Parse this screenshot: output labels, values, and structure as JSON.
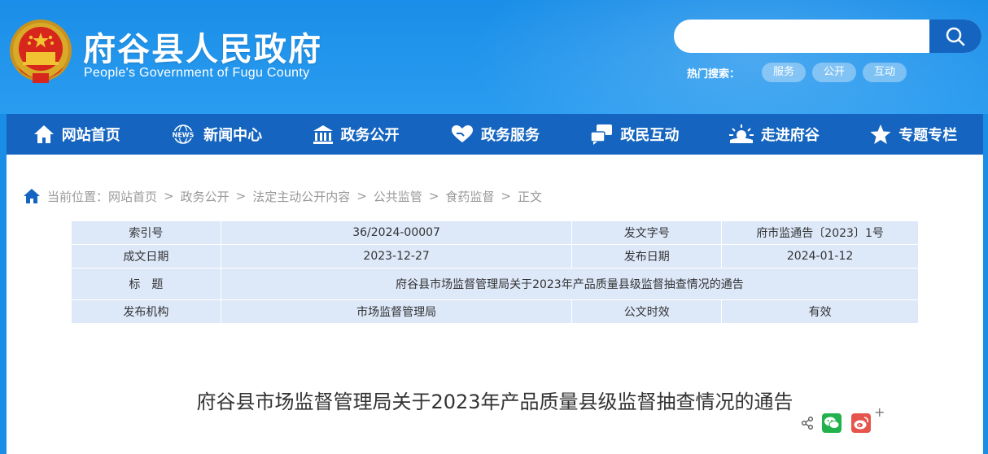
{
  "header": {
    "title": "府谷县人民政府",
    "subtitle": "People's Government of Fugu County",
    "search": {
      "placeholder": "",
      "button": "search"
    },
    "hot_label": "热门搜索：",
    "hot_tags": [
      "服务",
      "公开",
      "互动"
    ]
  },
  "nav": [
    {
      "label": "网站首页",
      "icon": "home-icon"
    },
    {
      "label": "新闻中心",
      "icon": "news-icon"
    },
    {
      "label": "政务公开",
      "icon": "building-icon"
    },
    {
      "label": "政务服务",
      "icon": "heart-hand-icon"
    },
    {
      "label": "政民互动",
      "icon": "chat-icon"
    },
    {
      "label": "走进府谷",
      "icon": "sunrise-icon"
    },
    {
      "label": "专题专栏",
      "icon": "star-icon"
    }
  ],
  "breadcrumb": {
    "label": "当前位置：",
    "items": [
      "网站首页",
      "政务公开",
      "法定主动公开内容",
      "公共监管",
      "食药监督"
    ],
    "current": "正文",
    "separator": ">"
  },
  "info": {
    "index_label": "索引号",
    "index_value": "36/2024-00007",
    "doc_no_label": "发文字号",
    "doc_no_value": "府市监通告〔2023〕1号",
    "date_label": "成文日期",
    "date_value": "2023-12-27",
    "publish_label": "发布日期",
    "publish_value": "2024-01-12",
    "title_label": "标　题",
    "title_value": "府谷县市场监督管理局关于2023年产品质量县级监督抽查情况的通告",
    "org_label": "发布机构",
    "org_value": "市场监督管理局",
    "validity_label": "公文时效",
    "validity_value": "有效"
  },
  "article": {
    "title": "府谷县市场监督管理局关于2023年产品质量县级监督抽查情况的通告"
  },
  "share": {
    "plus": "+",
    "icons": [
      "share-icon",
      "wechat-icon",
      "weibo-icon"
    ]
  },
  "colors": {
    "header_bg": "#1a8de6",
    "nav_bg": "#1565c0",
    "table_bg": "#dde8f9",
    "wechat": "#22b14c",
    "weibo": "#e6554d"
  }
}
